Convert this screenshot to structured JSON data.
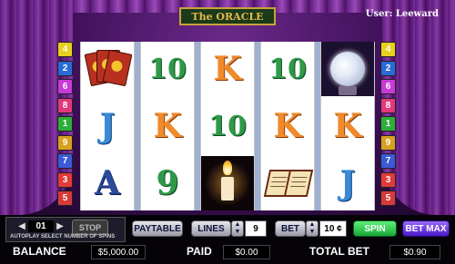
{
  "game": {
    "title": "The ORACLE",
    "user_label": "User: Leeward"
  },
  "paylines": {
    "left": [
      "4",
      "2",
      "6",
      "8",
      "1",
      "9",
      "7",
      "3",
      "5"
    ],
    "right": [
      "4",
      "2",
      "6",
      "8",
      "1",
      "9",
      "7",
      "3",
      "5"
    ],
    "colors": {
      "1": "#2eae3a",
      "2": "#2a6ad8",
      "3": "#e23a3a",
      "4": "#e8d020",
      "5": "#d83a3a",
      "6": "#c83ad8",
      "7": "#3a5ad8",
      "8": "#e03a7a",
      "9": "#d8a020"
    }
  },
  "reels": [
    {
      "symbols": [
        {
          "type": "icon",
          "name": "tarot-cards-icon"
        },
        {
          "type": "glyph",
          "text": "J",
          "color": "blue"
        },
        {
          "type": "glyph",
          "text": "A",
          "color": "darkblue"
        }
      ]
    },
    {
      "symbols": [
        {
          "type": "glyph",
          "text": "10",
          "color": "green"
        },
        {
          "type": "glyph",
          "text": "K",
          "color": "orange"
        },
        {
          "type": "glyph",
          "text": "9",
          "color": "green"
        }
      ]
    },
    {
      "symbols": [
        {
          "type": "glyph",
          "text": "K",
          "color": "orange"
        },
        {
          "type": "glyph",
          "text": "10",
          "color": "green"
        },
        {
          "type": "icon",
          "name": "candle-icon"
        }
      ]
    },
    {
      "symbols": [
        {
          "type": "glyph",
          "text": "10",
          "color": "green"
        },
        {
          "type": "glyph",
          "text": "K",
          "color": "orange"
        },
        {
          "type": "icon",
          "name": "spellbook-icon"
        }
      ]
    },
    {
      "symbols": [
        {
          "type": "icon",
          "name": "crystal-ball-icon"
        },
        {
          "type": "glyph",
          "text": "K",
          "color": "orange"
        },
        {
          "type": "glyph",
          "text": "J",
          "color": "blue"
        }
      ]
    }
  ],
  "controls": {
    "autoplay": {
      "count": "01",
      "stop_label": "STOP",
      "caption": "AUTOPLAY SELECT NUMBER OF SPINS"
    },
    "paytable_label": "PAYTABLE",
    "lines_label": "LINES",
    "lines_value": "9",
    "bet_label": "BET",
    "bet_value": "10 ¢",
    "spin_label": "SPIN",
    "betmax_label": "BET MAX"
  },
  "stats": {
    "balance_label": "BALANCE",
    "balance_value": "$5,000.00",
    "paid_label": "PAID",
    "paid_value": "$0.00",
    "total_bet_label": "TOTAL BET",
    "total_bet_value": "$0.90"
  },
  "colors": {
    "spin_button": "#1aa838",
    "betmax_button": "#4a1ac8",
    "title_text": "#e8b84a"
  }
}
